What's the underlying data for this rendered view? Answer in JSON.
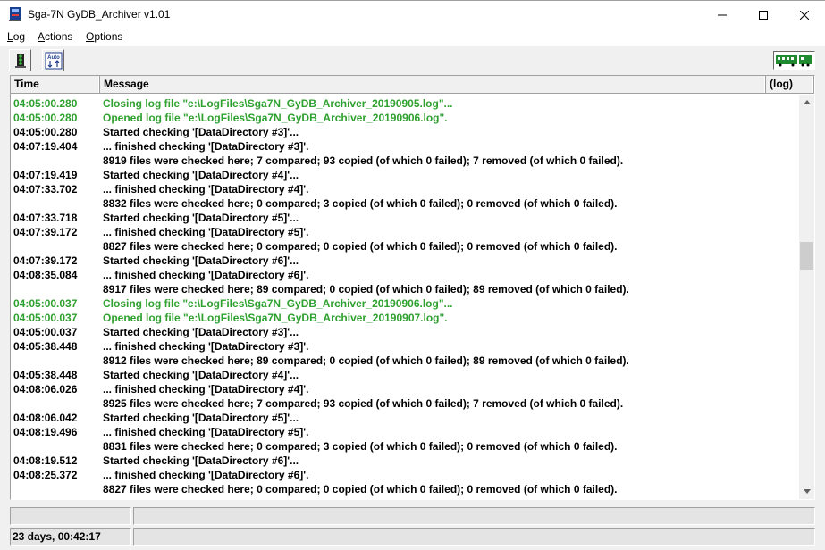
{
  "window": {
    "title": "Sga-7N GyDB_Archiver  v1.01",
    "minimize_glyph": "—",
    "maximize_glyph": "☐",
    "close_glyph": "✕"
  },
  "menu": {
    "log": {
      "accel": "L",
      "rest": "og"
    },
    "actions": {
      "accel": "A",
      "rest": "ctions"
    },
    "options": {
      "accel": "O",
      "rest": "ptions"
    }
  },
  "toolbar": {
    "button1_icon": "status-light-icon",
    "button2_icon": "auto-icon",
    "auto_label": "Auto",
    "right_indicator_icon": "train-icon"
  },
  "columns": {
    "time": "Time",
    "message": "Message",
    "log": "(log)"
  },
  "colors": {
    "green_text": "#2ea12e"
  },
  "rows": [
    {
      "time": "04:05:00.280",
      "message": "Closing log file \"e:\\LogFiles\\Sga7N_GyDB_Archiver_20190905.log\"...",
      "green": true
    },
    {
      "time": "04:05:00.280",
      "message": "Opened log file \"e:\\LogFiles\\Sga7N_GyDB_Archiver_20190906.log\".",
      "green": true
    },
    {
      "time": "04:05:00.280",
      "message": "Started checking '[DataDirectory #3]'...",
      "green": false
    },
    {
      "time": "04:07:19.404",
      "message": "... finished checking '[DataDirectory #3]'.",
      "green": false
    },
    {
      "time": "",
      "message": "8919 files were checked here;  7 compared;  93 copied (of which 0 failed);  7 removed (of which 0 failed).",
      "green": false
    },
    {
      "time": "04:07:19.419",
      "message": "Started checking '[DataDirectory #4]'...",
      "green": false
    },
    {
      "time": "04:07:33.702",
      "message": "... finished checking '[DataDirectory #4]'.",
      "green": false
    },
    {
      "time": "",
      "message": "8832 files were checked here;  0 compared;  3 copied (of which 0 failed);  0 removed (of which 0 failed).",
      "green": false
    },
    {
      "time": "04:07:33.718",
      "message": "Started checking '[DataDirectory #5]'...",
      "green": false
    },
    {
      "time": "04:07:39.172",
      "message": "... finished checking '[DataDirectory #5]'.",
      "green": false
    },
    {
      "time": "",
      "message": "8827 files were checked here;  0 compared;  0 copied (of which 0 failed);  0 removed (of which 0 failed).",
      "green": false
    },
    {
      "time": "04:07:39.172",
      "message": "Started checking '[DataDirectory #6]'...",
      "green": false
    },
    {
      "time": "04:08:35.084",
      "message": "... finished checking '[DataDirectory #6]'.",
      "green": false
    },
    {
      "time": "",
      "message": "8917 files were checked here;  89 compared;  0 copied (of which 0 failed);  89 removed (of which 0 failed).",
      "green": false
    },
    {
      "time": "04:05:00.037",
      "message": "Closing log file \"e:\\LogFiles\\Sga7N_GyDB_Archiver_20190906.log\"...",
      "green": true
    },
    {
      "time": "04:05:00.037",
      "message": "Opened log file \"e:\\LogFiles\\Sga7N_GyDB_Archiver_20190907.log\".",
      "green": true
    },
    {
      "time": "04:05:00.037",
      "message": "Started checking '[DataDirectory #3]'...",
      "green": false
    },
    {
      "time": "04:05:38.448",
      "message": "... finished checking '[DataDirectory #3]'.",
      "green": false
    },
    {
      "time": "",
      "message": "8912 files were checked here;  89 compared;  0 copied (of which 0 failed);  89 removed (of which 0 failed).",
      "green": false
    },
    {
      "time": "04:05:38.448",
      "message": "Started checking '[DataDirectory #4]'...",
      "green": false
    },
    {
      "time": "04:08:06.026",
      "message": "... finished checking '[DataDirectory #4]'.",
      "green": false
    },
    {
      "time": "",
      "message": "8925 files were checked here;  7 compared;  93 copied (of which 0 failed);  7 removed (of which 0 failed).",
      "green": false
    },
    {
      "time": "04:08:06.042",
      "message": "Started checking '[DataDirectory #5]'...",
      "green": false
    },
    {
      "time": "04:08:19.496",
      "message": "... finished checking '[DataDirectory #5]'.",
      "green": false
    },
    {
      "time": "",
      "message": "8831 files were checked here;  0 compared;  3 copied (of which 0 failed);  0 removed (of which 0 failed).",
      "green": false
    },
    {
      "time": "04:08:19.512",
      "message": "Started checking '[DataDirectory #6]'...",
      "green": false
    },
    {
      "time": "04:08:25.372",
      "message": "... finished checking '[DataDirectory #6]'.",
      "green": false
    },
    {
      "time": "",
      "message": "8827 files were checked here;  0 compared;  0 copied (of which 0 failed);  0 removed (of which 0 failed).",
      "green": false
    }
  ],
  "status": {
    "uptime": "23 days, 00:42:17"
  }
}
